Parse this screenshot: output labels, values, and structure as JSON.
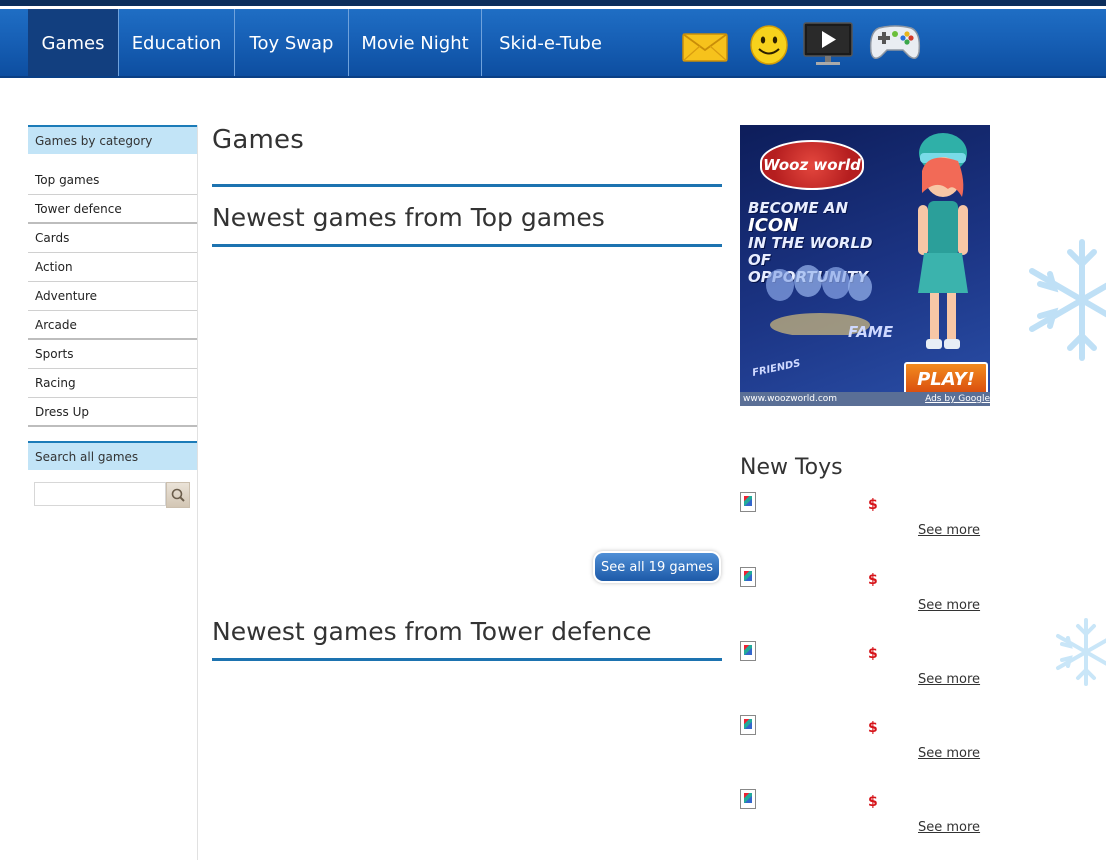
{
  "nav": {
    "items": [
      {
        "label": "Games",
        "active": true
      },
      {
        "label": "Education",
        "active": false
      },
      {
        "label": "Toy Swap",
        "active": false
      },
      {
        "label": "Movie Night",
        "active": false
      },
      {
        "label": "Skid-e-Tube",
        "active": false
      }
    ],
    "icons": [
      "mail-icon",
      "smiley-icon",
      "video-player-icon",
      "gamepad-icon"
    ]
  },
  "sidebar": {
    "category_heading": "Games by category",
    "categories": [
      "Top games",
      "Tower defence",
      "Cards",
      "Action",
      "Adventure",
      "Arcade",
      "Sports",
      "Racing",
      "Dress Up"
    ],
    "search_heading": "Search all games",
    "search_value": ""
  },
  "main": {
    "title": "Games",
    "sections": [
      {
        "title": "Newest games from Top games",
        "see_all_label": "See all 19 games"
      },
      {
        "title": "Newest games from Tower defence"
      }
    ]
  },
  "ad": {
    "brand": "Wooz world",
    "headline_1": "BECOME AN",
    "headline_icon": "ICON",
    "headline_2": "IN THE WORLD OF",
    "headline_3": "OPPORTUNITY",
    "fame": "FAME",
    "friends": "FRIENDS",
    "play": "PLAY!",
    "url": "www.woozworld.com",
    "ads_by": "Ads by Google"
  },
  "new_toys": {
    "title": "New Toys",
    "items": [
      {
        "price": "$",
        "more": "See more"
      },
      {
        "price": "$",
        "more": "See more"
      },
      {
        "price": "$",
        "more": "See more"
      },
      {
        "price": "$",
        "more": "See more"
      },
      {
        "price": "$",
        "more": "See more"
      }
    ]
  },
  "colors": {
    "nav_blue": "#1760b6",
    "nav_active": "#123f7f",
    "rule_blue": "#1d73b0",
    "side_head_bg": "#c2e4f7",
    "price_red": "#d6141a"
  }
}
